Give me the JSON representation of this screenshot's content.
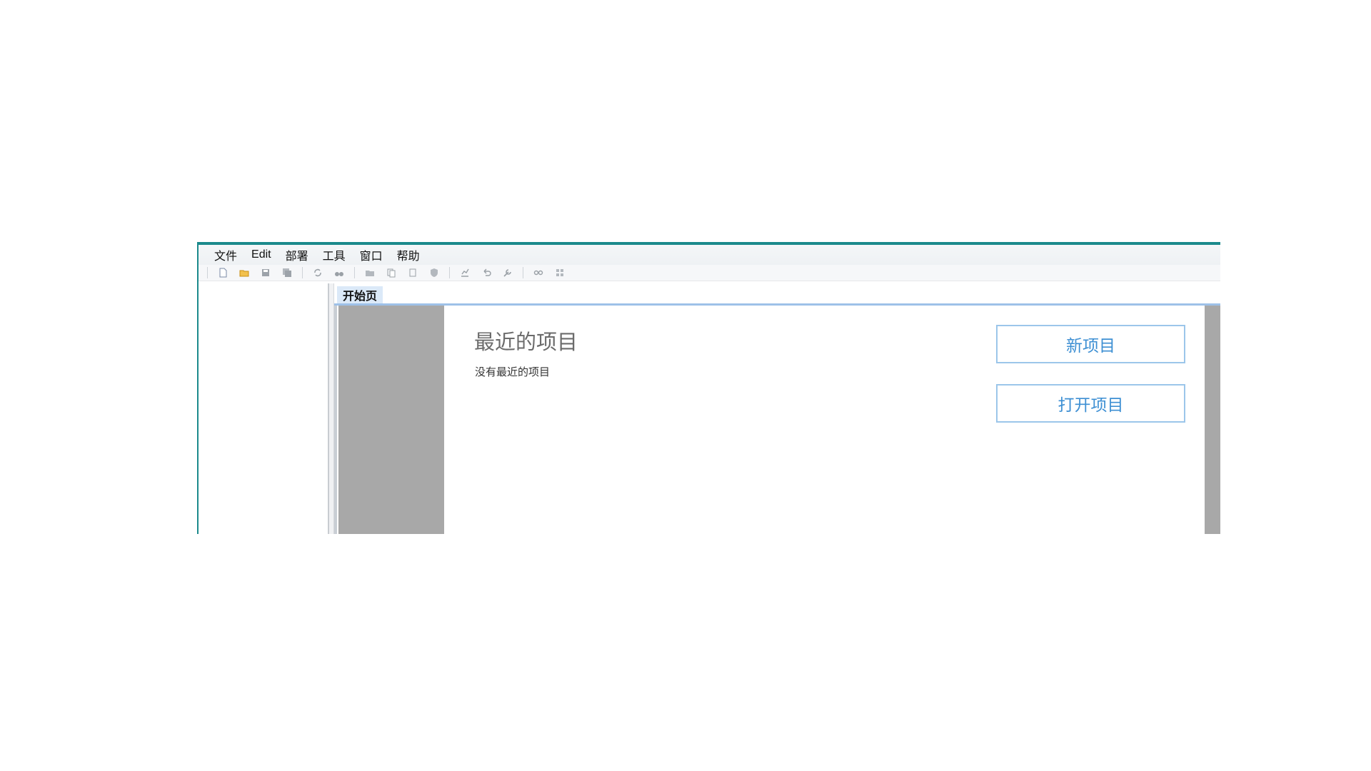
{
  "menubar": {
    "items": [
      {
        "label": "文件"
      },
      {
        "label": "Edit"
      },
      {
        "label": "部署"
      },
      {
        "label": "工具"
      },
      {
        "label": "窗口"
      },
      {
        "label": "帮助"
      }
    ]
  },
  "toolbar": {
    "icons": [
      "new-file-icon",
      "open-folder-icon",
      "save-icon",
      "save-all-icon",
      "refresh-icon",
      "search-binoculars-icon",
      "folder-icon",
      "copy-icon",
      "paste-icon",
      "shield-icon",
      "chart-icon",
      "undo-icon",
      "wrench-icon",
      "link-icon",
      "grid-icon"
    ]
  },
  "tabs": [
    {
      "label": "开始页"
    }
  ],
  "start_page": {
    "recent_title": "最近的项目",
    "recent_empty": "没有最近的项目",
    "new_project": "新项目",
    "open_project": "打开项目"
  },
  "colors": {
    "window_border": "#1b8a8c",
    "tab_active_bg": "#dbe9f8",
    "tab_underline": "#9ec1e8",
    "button_border": "#9cc6ea",
    "button_text": "#3d8fd3",
    "side_gray": "#a8a8a8"
  }
}
